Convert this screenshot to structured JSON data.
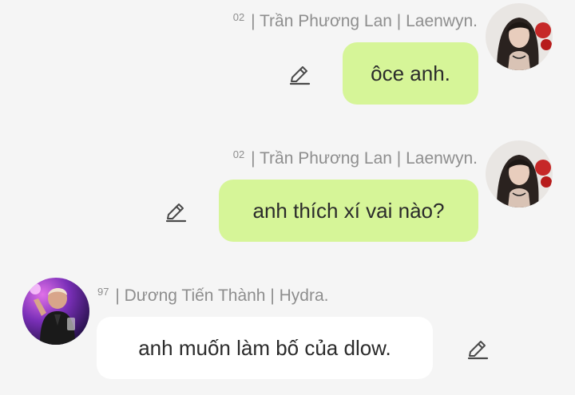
{
  "messages": [
    {
      "direction": "outgoing",
      "sender": {
        "index": "02",
        "name": "| Trần Phương Lan | Laenwyn."
      },
      "text": "ôce anh.",
      "edit_icon": "pencil-icon",
      "avatar": "avatar-woman-dark-hair"
    },
    {
      "direction": "outgoing",
      "sender": {
        "index": "02",
        "name": "| Trần Phương Lan | Laenwyn."
      },
      "text": "anh thích xí vai nào?",
      "edit_icon": "pencil-icon",
      "avatar": "avatar-woman-dark-hair"
    },
    {
      "direction": "incoming",
      "sender": {
        "index": "97",
        "name": "| Dương Tiến Thành | Hydra."
      },
      "text": "anh muốn làm bố của dlow.",
      "edit_icon": "pencil-icon",
      "avatar": "avatar-man-purple-light"
    }
  ],
  "colors": {
    "background": "#f5f5f5",
    "outgoing_bubble": "#d6f598",
    "incoming_bubble": "#ffffff",
    "sender_text": "#8e8e8e",
    "message_text": "#2b2b2b"
  }
}
